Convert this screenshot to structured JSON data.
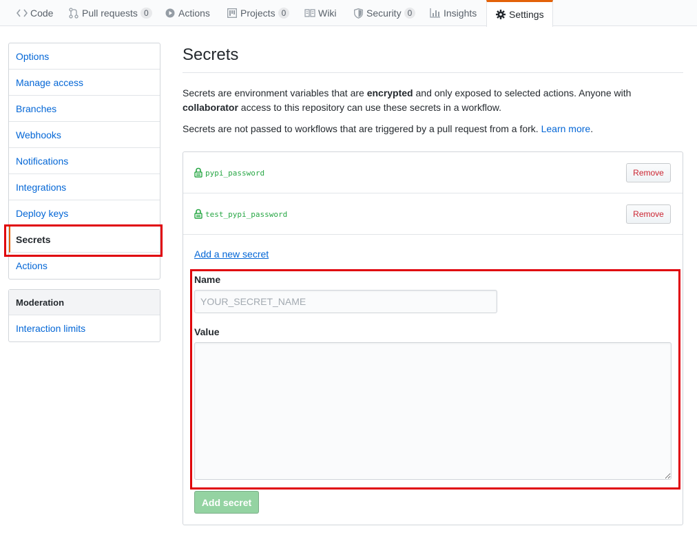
{
  "tabs": [
    {
      "label": "Code",
      "icon": "code-icon"
    },
    {
      "label": "Pull requests",
      "icon": "git-pull-request-icon",
      "count": "0"
    },
    {
      "label": "Actions",
      "icon": "play-icon"
    },
    {
      "label": "Projects",
      "icon": "project-icon",
      "count": "0"
    },
    {
      "label": "Wiki",
      "icon": "book-icon"
    },
    {
      "label": "Security",
      "icon": "shield-icon",
      "count": "0"
    },
    {
      "label": "Insights",
      "icon": "graph-icon"
    },
    {
      "label": "Settings",
      "icon": "gear-icon",
      "selected": true
    }
  ],
  "sidebar": {
    "items": [
      {
        "label": "Options"
      },
      {
        "label": "Manage access"
      },
      {
        "label": "Branches"
      },
      {
        "label": "Webhooks"
      },
      {
        "label": "Notifications"
      },
      {
        "label": "Integrations"
      },
      {
        "label": "Deploy keys"
      },
      {
        "label": "Secrets",
        "selected": true
      },
      {
        "label": "Actions"
      }
    ],
    "moderation": {
      "heading": "Moderation",
      "items": [
        {
          "label": "Interaction limits"
        }
      ]
    }
  },
  "main": {
    "title": "Secrets",
    "intro": {
      "p1_a": "Secrets are environment variables that are ",
      "p1_b": "encrypted",
      "p1_c": " and only exposed to selected actions. Anyone with ",
      "p1_d": "collaborator",
      "p1_e": " access to this repository can use these secrets in a workflow.",
      "p2_a": "Secrets are not passed to workflows that are triggered by a pull request from a fork. ",
      "p2_link": "Learn more",
      "p2_end": "."
    },
    "secrets": [
      {
        "name": "pypi_password",
        "action": "Remove"
      },
      {
        "name": "test_pypi_password",
        "action": "Remove"
      }
    ],
    "form": {
      "add_link": "Add a new secret",
      "name_label": "Name",
      "name_placeholder": "YOUR_SECRET_NAME",
      "name_value": "",
      "value_label": "Value",
      "value_value": "",
      "submit_label": "Add secret"
    }
  },
  "colors": {
    "accent": "#e36209",
    "link": "#0366d6",
    "secret_green": "#28a745",
    "danger": "#cb2431",
    "highlight": "#e0000a"
  }
}
